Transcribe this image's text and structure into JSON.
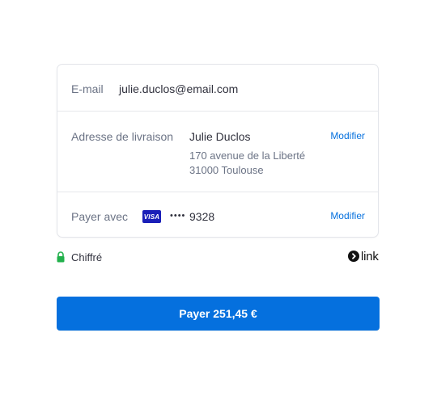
{
  "email": {
    "label": "E-mail",
    "value": "julie.duclos@email.com"
  },
  "shipping": {
    "label": "Adresse de livraison",
    "name": "Julie Duclos",
    "address_line1": "170 avenue de la Liberté",
    "address_line2": "31000 Toulouse",
    "edit_label": "Modifier"
  },
  "payment": {
    "label": "Payer avec",
    "card_brand": "VISA",
    "masked_dots": "••••",
    "last4": "9328",
    "edit_label": "Modifier"
  },
  "security": {
    "text": "Chiffré",
    "icon": "lock-icon",
    "icon_color": "#22b14c"
  },
  "brand": {
    "logo_text": "link"
  },
  "pay_button": {
    "label": "Payer 251,45 €",
    "color": "#0570de"
  },
  "colors": {
    "accent": "#0570de",
    "visa_blue": "#1a1fb8",
    "text_primary": "#30313d",
    "text_secondary": "#6b7385"
  }
}
